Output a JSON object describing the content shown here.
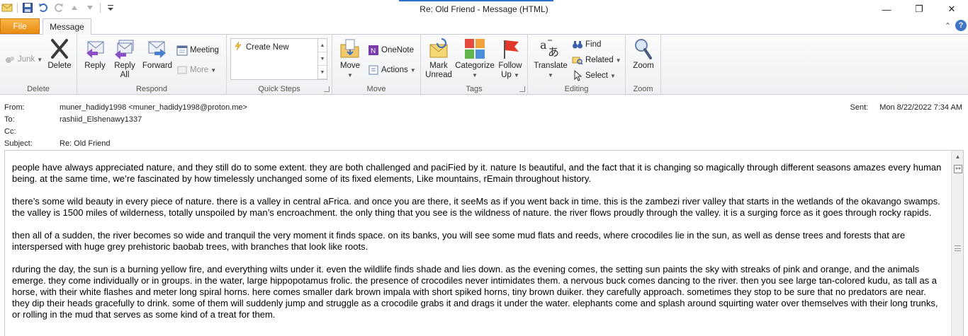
{
  "window": {
    "title": "Re: Old Friend  -  Message (HTML)",
    "minimize": "—",
    "restore": "❐",
    "close": "✕"
  },
  "tabs": {
    "file": "File",
    "message": "Message",
    "collapse_glyph": "⌃",
    "help_glyph": "?"
  },
  "ribbon": {
    "delete_group": {
      "label": "Delete",
      "junk": "Junk",
      "delete": "Delete"
    },
    "respond_group": {
      "label": "Respond",
      "reply": "Reply",
      "reply_all_1": "Reply",
      "reply_all_2": "All",
      "forward": "Forward",
      "meeting": "Meeting",
      "more": "More"
    },
    "quick_steps_group": {
      "label": "Quick Steps",
      "create_new": "Create New"
    },
    "move_group": {
      "label": "Move",
      "move": "Move",
      "onenote": "OneNote",
      "actions": "Actions"
    },
    "tags_group": {
      "label": "Tags",
      "mark_unread_1": "Mark",
      "mark_unread_2": "Unread",
      "categorize": "Categorize",
      "follow_up_1": "Follow",
      "follow_up_2": "Up"
    },
    "editing_group": {
      "label": "Editing",
      "translate": "Translate",
      "find": "Find",
      "related": "Related",
      "select": "Select"
    },
    "zoom_group": {
      "label": "Zoom",
      "zoom": "Zoom"
    }
  },
  "header": {
    "from_label": "From:",
    "from_value": "muner_hadidy1998 <muner_hadidy1998@proton.me>",
    "to_label": "To:",
    "to_value": "rashiid_Elshenawy1337",
    "cc_label": "Cc:",
    "cc_value": "",
    "subject_label": "Subject:",
    "subject_value": "Re: Old Friend",
    "sent_label": "Sent:",
    "sent_value": "Mon 8/22/2022 7:34 AM"
  },
  "body": {
    "paragraphs": [
      "people have always appreciated nature, and they still do to some extent. they are both challenged and paciFied by it. nature Is beautiful, and the fact that it is changing so magically through different seasons amazes every human being. at the same time, we’re fascinated by how timelessly unchanged some of its fixed elements, Like mountains, rEmain throughout history.",
      "there’s some wild beauty in every piece of nature. there is a valley in central aFrica. and once you are there, it seeMs as if you went back in time. this is the zambezi river valley that starts in the wetlands of the okavango swamps. the valley is 1500 miles of wilderness, totally unspoiled by man’s encroachment. the only thing that you see is the wildness of nature. the river flows proudly through the valley. it is a surging force as it goes through rocky rapids.",
      "then all of a sudden, the river becomes so wide and tranquil the very moment it finds space. on its banks, you will see some mud flats and reeds, where crocodiles lie in the sun, as well as dense trees and forests that are interspersed with huge grey prehistoric baobab trees, with branches that look like roots.",
      "rduring the day, the sun is a burning yellow fire, and everything wilts under it. even the wildlife finds shade and lies down. as the evening comes, the setting sun paints the sky with streaks of pink and orange, and the animals emerge. they come individually or in groups. in the water, large hippopotamus frolic. the presence of crocodiles never intimidates them. a nervous buck comes dancing to the river. then you see large tan-colored kudu, as tall as a horse, with their white flashes and meter long spiral horns. here comes smaller dark brown impala with short spiked horns, tiny brown duiker. they carefully approach. sometimes they stop to be sure that no predators are near. they dip their heads gracefully to drink. some of them will suddenly jump and struggle as a crocodile grabs it and drags it under the water. elephants come and splash around squirting water over themselves with their long trunks, or rolling in the mud that serves as some kind of a treat for them."
    ]
  },
  "scrollbar": {
    "up": "▲",
    "down": "▼"
  },
  "colors": {
    "file_tab": "#e98c0f",
    "accent": "#2b74c8"
  }
}
